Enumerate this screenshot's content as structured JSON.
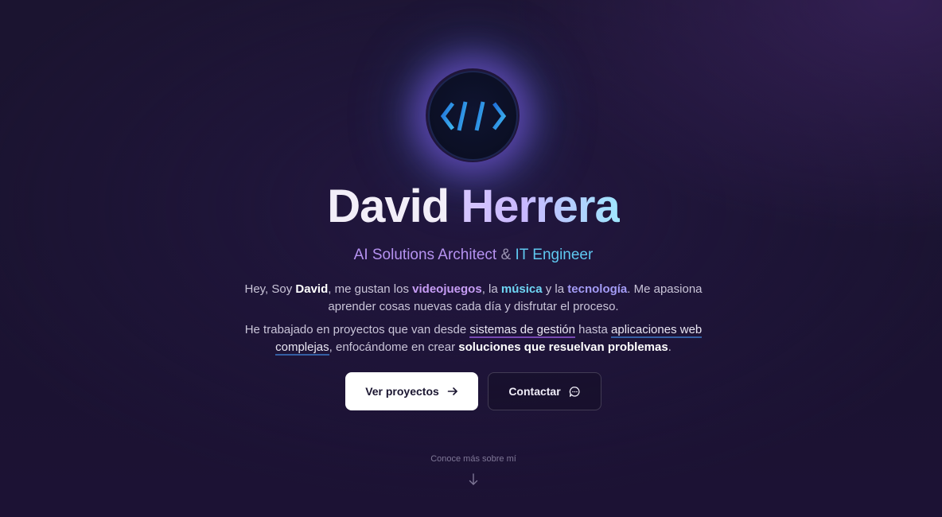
{
  "hero": {
    "name_first": "David",
    "name_last": "Herrera",
    "subtitle_role1": "AI Solutions Architect",
    "subtitle_amp": "&",
    "subtitle_role2": "IT Engineer"
  },
  "intro": {
    "p1_a": "Hey, Soy ",
    "p1_name": "David",
    "p1_b": ", me gustan los ",
    "p1_games": "videojuegos",
    "p1_c": ", la ",
    "p1_music": "música",
    "p1_d": " y la ",
    "p1_tech": "tecnología",
    "p1_e": ". Me apasiona aprender cosas nuevas cada día y disfrutar el proceso.",
    "p2_a": "He trabajado en proyectos que van desde ",
    "p2_link1": "sistemas de gestión",
    "p2_b": " hasta ",
    "p2_link2": "aplicaciones web complejas",
    "p2_c": ", enfocándome en crear ",
    "p2_strong": "soluciones que resuelvan problemas",
    "p2_d": "."
  },
  "actions": {
    "projects_label": "Ver proyectos",
    "contact_label": "Contactar"
  },
  "scroll": {
    "hint": "Conoce más sobre mí"
  },
  "icons": {
    "logo": "dh-code-logo-icon",
    "arrow_right": "arrow-right-icon",
    "chat": "chat-bubble-icon",
    "arrow_down": "arrow-down-icon"
  },
  "colors": {
    "accent_purple": "#c79df5",
    "accent_cyan": "#6fd6f5",
    "background": "#1b1430"
  }
}
